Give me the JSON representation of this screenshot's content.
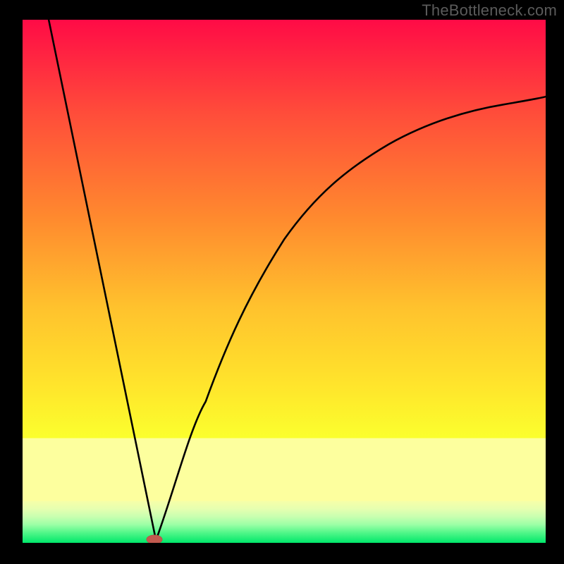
{
  "watermark": "TheBottleneck.com",
  "chart_data": {
    "type": "line",
    "title": "",
    "xlabel": "",
    "ylabel": "",
    "xlim": [
      0,
      100
    ],
    "ylim": [
      0,
      100
    ],
    "grid": false,
    "legend": false,
    "background_gradient": {
      "top": "#ff0b46",
      "mid_upper": "#ff842f",
      "mid": "#ffd82e",
      "mid_lower": "#f7ff2e",
      "band": "#fcff9d",
      "bottom": "#00e86a"
    },
    "series": [
      {
        "name": "left_leg",
        "type": "line",
        "x": [
          5,
          25.5
        ],
        "y": [
          100,
          0.5
        ],
        "stroke": "#000",
        "note": "near-linear descent from top-left to valley"
      },
      {
        "name": "right_leg",
        "type": "line",
        "x": [
          25.5,
          30,
          35,
          40,
          45,
          50,
          55,
          60,
          65,
          70,
          75,
          80,
          85,
          90,
          95,
          100
        ],
        "y": [
          0.5,
          13,
          27,
          40,
          50,
          58,
          64.5,
          69.5,
          73.2,
          76.2,
          78.5,
          80.4,
          82,
          83.3,
          84.4,
          85.3
        ],
        "stroke": "#000",
        "note": "curved ascent, decelerating toward upper right"
      }
    ],
    "marker": {
      "name": "valley_marker",
      "x": 25.2,
      "y": 0.2,
      "rx": 1.2,
      "ry": 0.7,
      "fill": "#c25a4f"
    }
  }
}
